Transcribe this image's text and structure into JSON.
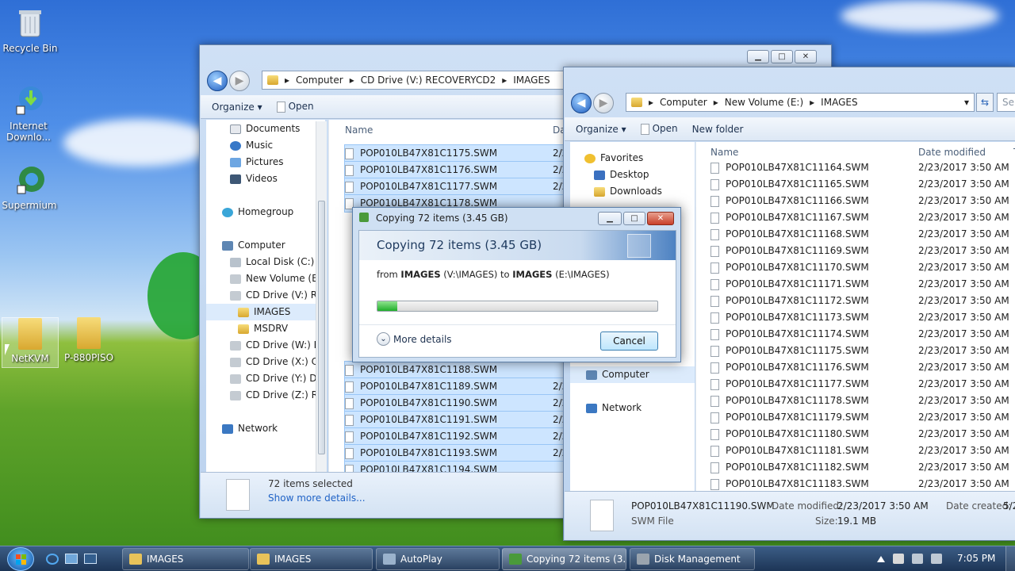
{
  "desktop": {
    "icons": [
      {
        "label": "Recycle Bin"
      },
      {
        "label": "Internet Downlo..."
      },
      {
        "label": "Supermium"
      },
      {
        "label": "NetKVM"
      },
      {
        "label": "P-880PISO"
      }
    ]
  },
  "window_left": {
    "breadcrumb": [
      "Computer",
      "CD Drive (V:) RECOVERYCD2",
      "IMAGES"
    ],
    "toolbar": {
      "organize": "Organize",
      "open": "Open"
    },
    "nav": [
      {
        "label": "Documents"
      },
      {
        "label": "Music"
      },
      {
        "label": "Pictures"
      },
      {
        "label": "Videos"
      },
      {
        "label": "Homegroup"
      },
      {
        "label": "Computer"
      },
      {
        "label": "Local Disk (C:)"
      },
      {
        "label": "New Volume (E:)"
      },
      {
        "label": "CD Drive (V:) REC"
      },
      {
        "label": "IMAGES"
      },
      {
        "label": "MSDRV"
      },
      {
        "label": "CD Drive (W:) REC"
      },
      {
        "label": "CD Drive (X:) CD_"
      },
      {
        "label": "CD Drive (Y:) DVD"
      },
      {
        "label": "CD Drive (Z:) REC"
      },
      {
        "label": "Network"
      }
    ],
    "columns": {
      "name": "Name",
      "date": "Da"
    },
    "files_top": [
      "POP010LB47X81C1175.SWM",
      "POP010LB47X81C1176.SWM",
      "POP010LB47X81C1177.SWM",
      "POP010LB47X81C1178.SWM"
    ],
    "files_bottom": [
      "POP010LB47X81C1188.SWM",
      "POP010LB47X81C1189.SWM",
      "POP010LB47X81C1190.SWM",
      "POP010LB47X81C1191.SWM",
      "POP010LB47X81C1192.SWM",
      "POP010LB47X81C1193.SWM",
      "POP010LB47X81C1194.SWM"
    ],
    "date_prefix": "2/2",
    "status": {
      "selected": "72 items selected",
      "details_link": "Show more details..."
    }
  },
  "window_right": {
    "breadcrumb": [
      "Computer",
      "New Volume (E:)",
      "IMAGES"
    ],
    "search_placeholder": "Se",
    "toolbar": {
      "organize": "Organize",
      "open": "Open",
      "new_folder": "New folder"
    },
    "nav": [
      {
        "label": "Favorites"
      },
      {
        "label": "Desktop"
      },
      {
        "label": "Downloads"
      },
      {
        "label": "Computer"
      },
      {
        "label": "Network"
      }
    ],
    "columns": {
      "name": "Name",
      "date": "Date modified",
      "type": "T"
    },
    "files": [
      {
        "name": "POP010LB47X81C11164.SWM",
        "date": "2/23/2017 3:50 AM"
      },
      {
        "name": "POP010LB47X81C11165.SWM",
        "date": "2/23/2017 3:50 AM"
      },
      {
        "name": "POP010LB47X81C11166.SWM",
        "date": "2/23/2017 3:50 AM"
      },
      {
        "name": "POP010LB47X81C11167.SWM",
        "date": "2/23/2017 3:50 AM"
      },
      {
        "name": "POP010LB47X81C11168.SWM",
        "date": "2/23/2017 3:50 AM"
      },
      {
        "name": "POP010LB47X81C11169.SWM",
        "date": "2/23/2017 3:50 AM"
      },
      {
        "name": "POP010LB47X81C11170.SWM",
        "date": "2/23/2017 3:50 AM"
      },
      {
        "name": "POP010LB47X81C11171.SWM",
        "date": "2/23/2017 3:50 AM"
      },
      {
        "name": "POP010LB47X81C11172.SWM",
        "date": "2/23/2017 3:50 AM"
      },
      {
        "name": "POP010LB47X81C11173.SWM",
        "date": "2/23/2017 3:50 AM"
      },
      {
        "name": "POP010LB47X81C11174.SWM",
        "date": "2/23/2017 3:50 AM"
      },
      {
        "name": "POP010LB47X81C11175.SWM",
        "date": "2/23/2017 3:50 AM"
      },
      {
        "name": "POP010LB47X81C11176.SWM",
        "date": "2/23/2017 3:50 AM"
      },
      {
        "name": "POP010LB47X81C11177.SWM",
        "date": "2/23/2017 3:50 AM"
      },
      {
        "name": "POP010LB47X81C11178.SWM",
        "date": "2/23/2017 3:50 AM"
      },
      {
        "name": "POP010LB47X81C11179.SWM",
        "date": "2/23/2017 3:50 AM"
      },
      {
        "name": "POP010LB47X81C11180.SWM",
        "date": "2/23/2017 3:50 AM"
      },
      {
        "name": "POP010LB47X81C11181.SWM",
        "date": "2/23/2017 3:50 AM"
      },
      {
        "name": "POP010LB47X81C11182.SWM",
        "date": "2/23/2017 3:50 AM"
      },
      {
        "name": "POP010LB47X81C11183.SWM",
        "date": "2/23/2017 3:50 AM"
      }
    ],
    "details": {
      "filename": "POP010LB47X81C11190.SWM",
      "filetype": "SWM File",
      "date_modified_label": "Date modified:",
      "date_modified": "2/23/2017 3:50 AM",
      "size_label": "Size:",
      "size": "19.1 MB",
      "date_created_label": "Date created:",
      "date_created": "5/2"
    }
  },
  "copy_dialog": {
    "title": "Copying 72 items (3.45 GB)",
    "heading": "Copying 72 items (3.45 GB)",
    "from_word": "from",
    "source_name": "IMAGES",
    "source_path": "(V:\\IMAGES)",
    "to_word": "to",
    "dest_name": "IMAGES",
    "dest_path": "(E:\\IMAGES)",
    "progress": 0.07,
    "more_details": "More details",
    "cancel": "Cancel"
  },
  "taskbar": {
    "buttons": [
      {
        "label": "IMAGES"
      },
      {
        "label": "IMAGES"
      },
      {
        "label": "AutoPlay"
      },
      {
        "label": "Copying 72 items (3..."
      },
      {
        "label": "Disk Management"
      }
    ],
    "clock": "7:05 PM"
  },
  "colors": {
    "accent": "#1e5cbf",
    "progress": "#2fbf3f",
    "selection": "#cde5ff"
  }
}
